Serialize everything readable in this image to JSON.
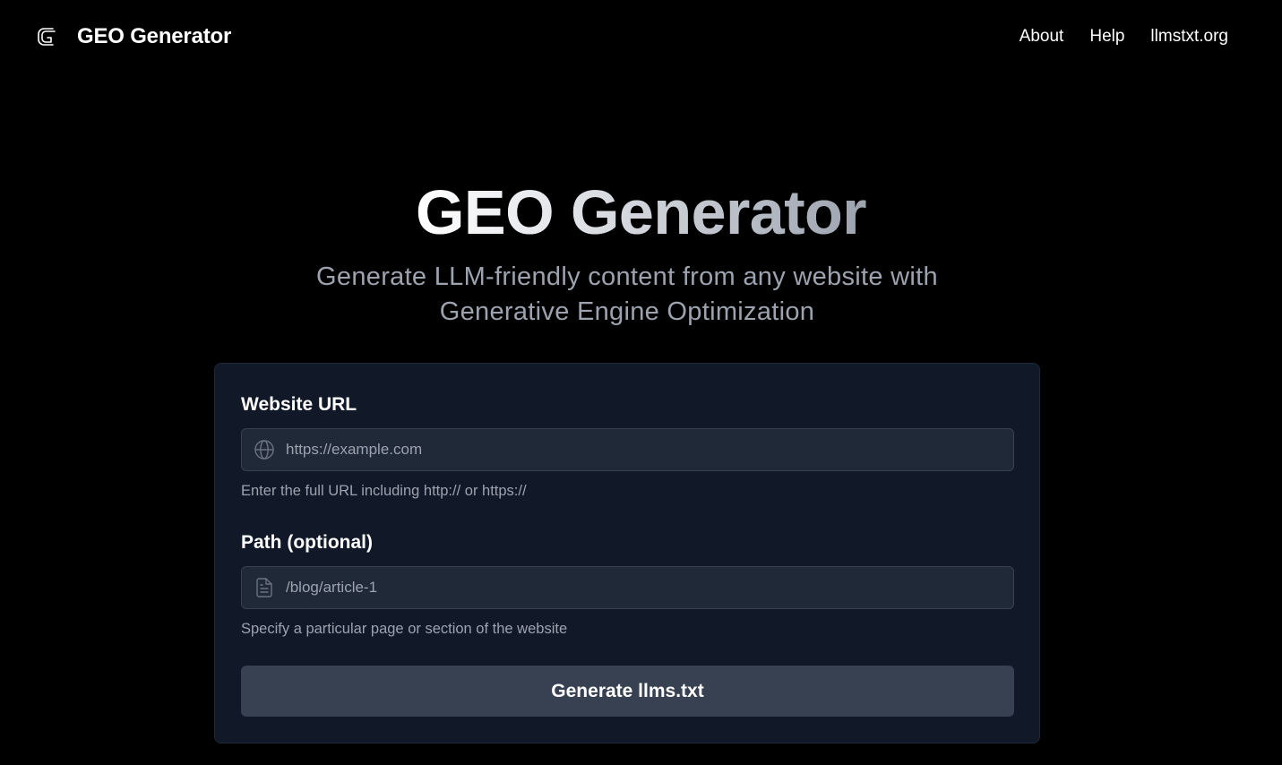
{
  "header": {
    "brand_name": "GEO Generator",
    "logo_icon": "geo-logo-icon",
    "nav": [
      {
        "label": "About"
      },
      {
        "label": "Help"
      },
      {
        "label": "llmstxt.org"
      }
    ]
  },
  "hero": {
    "title": "GEO Generator",
    "subtitle": "Generate LLM-friendly content from any website with Generative Engine Optimization"
  },
  "form": {
    "url": {
      "label": "Website URL",
      "placeholder": "https://example.com",
      "value": "",
      "icon": "globe-icon",
      "hint": "Enter the full URL including http:// or https://"
    },
    "path": {
      "label": "Path (optional)",
      "placeholder": "/blog/article-1",
      "value": "",
      "icon": "document-icon",
      "hint": "Specify a particular page or section of the website"
    },
    "submit_label": "Generate llms.txt"
  },
  "colors": {
    "background": "#000000",
    "card": "#111827",
    "input": "#1f2937",
    "button": "#374151",
    "muted_text": "#9ca3af"
  }
}
